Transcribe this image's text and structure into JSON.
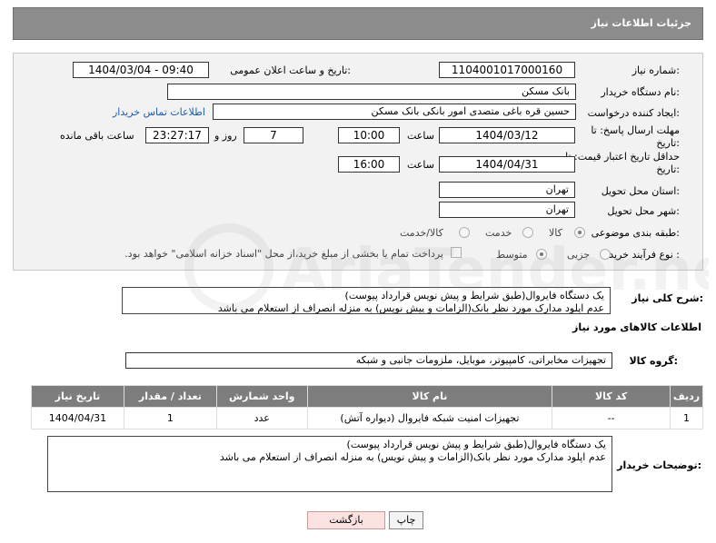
{
  "header": {
    "title": "جزئیات اطلاعات نیاز"
  },
  "form": {
    "need_number_label": "شماره نیاز:",
    "need_number": "1104001017000160",
    "announce_label": "تاریخ و ساعت اعلان عمومی:",
    "announce_value": "1404/03/04 - 09:40",
    "buyer_org_label": "نام دستگاه خریدار:",
    "buyer_org": "بانک مسکن",
    "creator_label": "ایجاد کننده درخواست:",
    "creator": "حسین  قره باغی متصدی امور بانکی بانک مسکن",
    "contact_link": "اطلاعات تماس خریدار",
    "deadline_label": "مهلت ارسال پاسخ: تا تاریخ:",
    "deadline_date": "1404/03/12",
    "time_label": "ساعت",
    "deadline_time": "10:00",
    "days_value": "7",
    "days_label": "روز و",
    "remaining_time": "23:27:17",
    "remaining_label": "ساعت باقی مانده",
    "validity_label": "حداقل تاریخ اعتبار قیمت: تا تاریخ:",
    "validity_date": "1404/04/31",
    "validity_time_label": "ساعت",
    "validity_time": "16:00",
    "province_label": "استان محل تحویل:",
    "province": "تهران",
    "city_label": "شهر محل تحویل:",
    "city": "تهران",
    "category_label": "طبقه بندی موضوعی:",
    "category_options": [
      "کالا",
      "خدمت",
      "کالا/خدمت"
    ],
    "process_label": "نوع فرآیند خرید :",
    "process_options": [
      "جزیی",
      "متوسط"
    ],
    "payment_note": "پرداخت تمام یا بخشی از مبلغ خرید،از محل \"اسناد خزانه اسلامی\" خواهد بود."
  },
  "summary": {
    "label": "شرح کلی نیاز:",
    "line1": "یک دستگاه فایروال(طبق شرایط و پیش نویس قرارداد پیوست)",
    "line2": "عدم اپلود مدارک مورد نظر بانک(الزامات و پیش نویس) به منزله انصراف از استعلام می باشد"
  },
  "goods": {
    "section_title": "اطلاعات کالاهای مورد نیاز",
    "group_label": "گروه کالا:",
    "group_value": "تجهیزات مخابراتی، کامپیوتر، موبایل، ملزومات جانبی و شبکه",
    "columns": [
      "ردیف",
      "کد کالا",
      "نام کالا",
      "واحد شمارش",
      "تعداد / مقدار",
      "تاریخ نیاز"
    ],
    "rows": [
      {
        "index": "1",
        "code": "--",
        "name": "تجهیزات امنیت شبکه فایروال (دیواره آتش)",
        "unit": "عدد",
        "qty": "1",
        "date": "1404/04/31"
      }
    ]
  },
  "buyer_notes": {
    "label": "توضیحات خریدار:",
    "line1": "یک دستگاه فایروال(طبق شرایط و پیش نویس قرارداد پیوست)",
    "line2": "عدم اپلود مدارک مورد نظر بانک(الزامات و پیش نویس) به منزله انصراف از استعلام می باشد"
  },
  "actions": {
    "print_label": "چاپ",
    "back_label": "بازگشت"
  },
  "watermark": {
    "text": "AriaTender.neT"
  }
}
